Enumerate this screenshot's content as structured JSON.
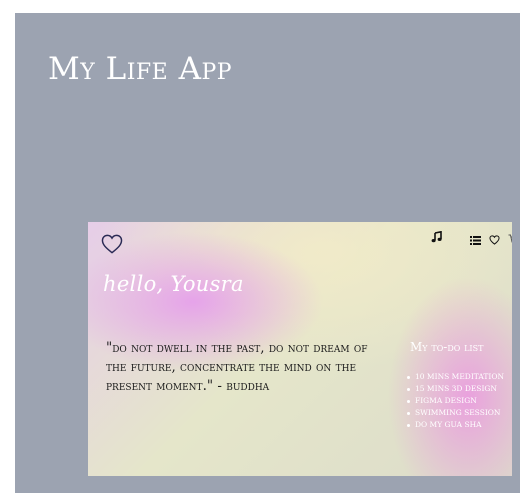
{
  "app": {
    "title": "My Life App"
  },
  "card": {
    "greeting": "hello, Yousra",
    "quote": "\"Do not dwell in the past, do not dream of the future, concentrate the mind on the present moment.\" - Buddha",
    "icons": [
      "heart-icon",
      "music-note-icon",
      "list-icon",
      "heart-outline-icon",
      "cart-icon"
    ]
  },
  "todo": {
    "title": "My to-do list",
    "items": [
      "10 mins meditation",
      "15 mins 3D design",
      "Figma design",
      "swimming session",
      "do my gua sha"
    ]
  },
  "colors": {
    "background": "#9ca3b1",
    "text_light": "#ffffff",
    "text_dark": "#1c1c1c",
    "accent_pink": "#e6a0eb",
    "accent_cream": "#f2ebc8"
  }
}
